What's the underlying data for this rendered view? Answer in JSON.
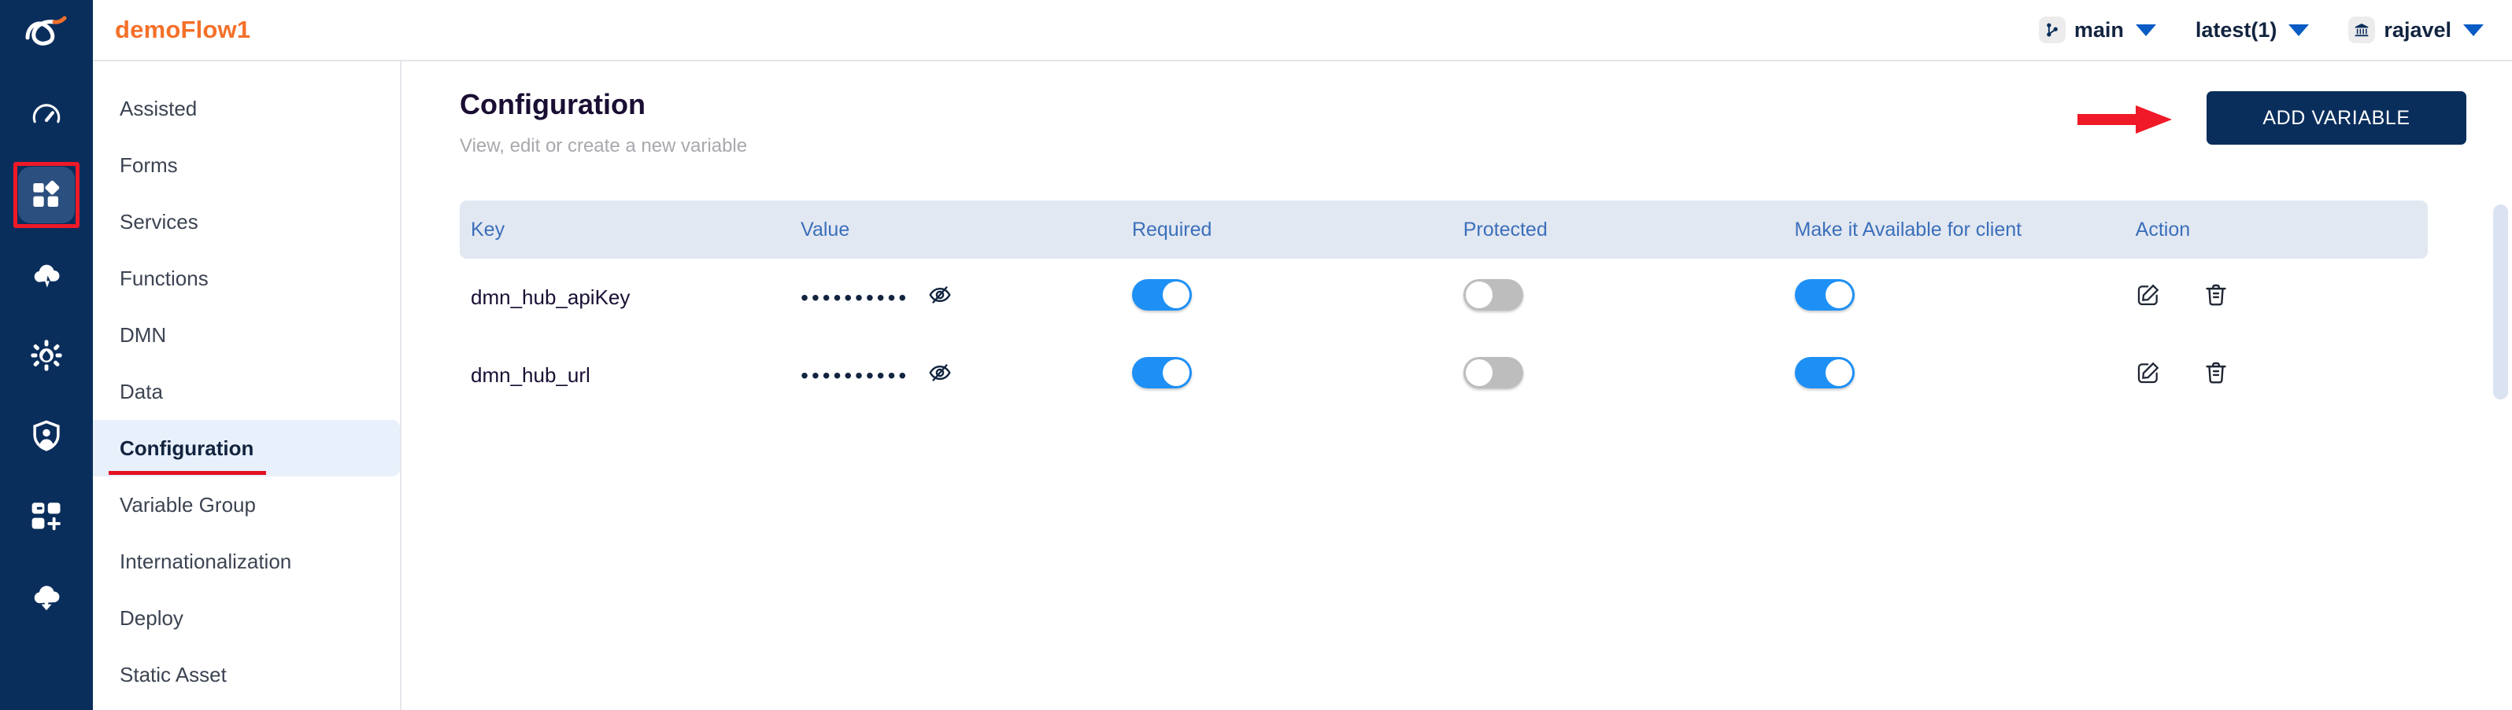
{
  "brand": {
    "logo_icon": "infinity-swoosh-logo",
    "accent_orange": "#f4702a",
    "rail_bg": "#0a2e5c",
    "annotation_red": "#e4111f"
  },
  "icon_rail": {
    "items": [
      {
        "icon": "gauge-dashboard-icon",
        "active": false,
        "annotated": false
      },
      {
        "icon": "apps-grid-icon",
        "active": true,
        "annotated": true
      },
      {
        "icon": "cloud-lightning-icon",
        "active": false,
        "annotated": false
      },
      {
        "icon": "data-droplet-wheel-icon",
        "active": false,
        "annotated": false
      },
      {
        "icon": "shield-user-icon",
        "active": false,
        "annotated": false
      },
      {
        "icon": "apps-add-icon",
        "active": false,
        "annotated": false
      },
      {
        "icon": "cloud-download-icon",
        "active": false,
        "annotated": false
      }
    ]
  },
  "header": {
    "flow_title": "demoFlow1",
    "branch": {
      "icon": "git-branch-icon",
      "label": "main",
      "caret": "chevron-down-icon"
    },
    "version": {
      "label": "latest(1)",
      "caret": "chevron-down-icon"
    },
    "workspace": {
      "icon": "bank-institution-icon",
      "label": "rajavel",
      "caret": "chevron-down-icon"
    }
  },
  "sidebar": {
    "items": [
      {
        "label": "Assisted",
        "selected": false
      },
      {
        "label": "Forms",
        "selected": false
      },
      {
        "label": "Services",
        "selected": false
      },
      {
        "label": "Functions",
        "selected": false
      },
      {
        "label": "DMN",
        "selected": false
      },
      {
        "label": "Data",
        "selected": false
      },
      {
        "label": "Configuration",
        "selected": true
      },
      {
        "label": "Variable Group",
        "selected": false
      },
      {
        "label": "Internationalization",
        "selected": false
      },
      {
        "label": "Deploy",
        "selected": false
      },
      {
        "label": "Static Asset",
        "selected": false
      }
    ]
  },
  "page": {
    "title": "Configuration",
    "subtitle": "View, edit or create a new variable",
    "add_variable_label": "ADD VARIABLE",
    "annotation_arrow": "red-arrow-pointing-right"
  },
  "table": {
    "columns": [
      "Key",
      "Value",
      "Required",
      "Protected",
      "Make it Available for client",
      "Action"
    ],
    "rows": [
      {
        "key": "dmn_hub_apiKey",
        "value_masked": "••••••••••",
        "value_visibility_icon": "eye-off-icon",
        "required": true,
        "protected": false,
        "available_for_client": true,
        "actions": [
          "edit-icon",
          "delete-icon"
        ]
      },
      {
        "key": "dmn_hub_url",
        "value_masked": "••••••••••",
        "value_visibility_icon": "eye-off-icon",
        "required": true,
        "protected": false,
        "available_for_client": true,
        "actions": [
          "edit-icon",
          "delete-icon"
        ]
      }
    ]
  },
  "colors": {
    "toggle_on": "#1e90f5",
    "toggle_off": "#bdbdbd",
    "table_header_bg": "#e2e8f2",
    "table_header_text": "#3b6fba",
    "button_navy": "#0a2e5c"
  }
}
